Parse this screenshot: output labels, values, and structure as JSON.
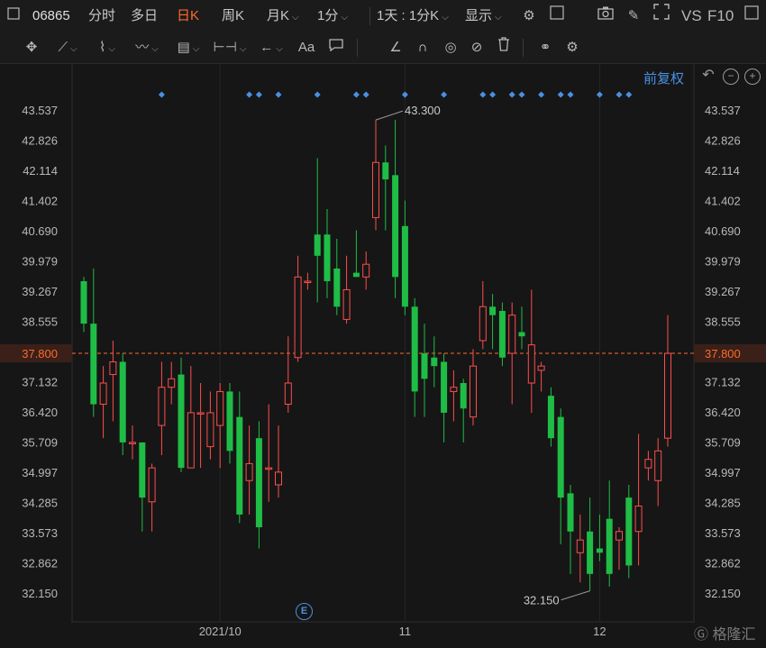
{
  "toolbar": {
    "stock_code": "06865",
    "tabs": [
      {
        "label": "分时",
        "active": false
      },
      {
        "label": "多日",
        "active": false
      },
      {
        "label": "日K",
        "active": true
      },
      {
        "label": "周K",
        "active": false
      },
      {
        "label": "月K",
        "active": false
      },
      {
        "label": "1分",
        "active": false
      },
      {
        "label": "1天 : 1分K",
        "active": false
      },
      {
        "label": "显示",
        "active": false
      }
    ],
    "vs_label": "VS",
    "f10_label": "F10",
    "draw_tools": {
      "text_tool": "Aa"
    }
  },
  "adjust": {
    "label": "前复权"
  },
  "colors": {
    "up": "#ff4d4d",
    "down": "#1fbd46",
    "accent": "#ff6a2c",
    "link": "#4a90e2"
  },
  "chart_data": {
    "type": "candlestick",
    "price_ticks": [
      "43.537",
      "42.826",
      "42.114",
      "41.402",
      "40.690",
      "39.979",
      "39.267",
      "38.555",
      "37.800",
      "37.132",
      "36.420",
      "35.709",
      "34.997",
      "34.285",
      "33.573",
      "32.862",
      "32.150"
    ],
    "current_price": "37.800",
    "x_labels": [
      {
        "label": "2021/10",
        "index": 14
      },
      {
        "label": "11",
        "index": 33
      },
      {
        "label": "12",
        "index": 53
      }
    ],
    "annotations": {
      "high": "43.300",
      "low": "32.150"
    },
    "event_badge": "E",
    "marker_indices": [
      8,
      17,
      18,
      20,
      24,
      28,
      29,
      33,
      37,
      41,
      42,
      44,
      45,
      47,
      49,
      50,
      53,
      55,
      56
    ],
    "candles": [
      [
        39.5,
        38.5,
        39.6,
        38.3
      ],
      [
        38.5,
        36.6,
        39.8,
        36.3
      ],
      [
        36.6,
        37.1,
        37.5,
        35.8
      ],
      [
        37.3,
        37.6,
        38.1,
        36.2
      ],
      [
        37.6,
        35.7,
        37.8,
        35.4
      ],
      [
        35.7,
        35.7,
        36.1,
        35.3
      ],
      [
        35.7,
        34.4,
        35.7,
        33.6
      ],
      [
        34.3,
        35.1,
        35.2,
        33.6
      ],
      [
        36.1,
        37.0,
        37.6,
        35.4
      ],
      [
        37.0,
        37.2,
        37.6,
        36.6
      ],
      [
        37.3,
        35.1,
        37.7,
        35.0
      ],
      [
        35.1,
        36.4,
        37.5,
        35.1
      ],
      [
        36.4,
        36.4,
        37.1,
        35.1
      ],
      [
        35.6,
        36.4,
        36.9,
        35.3
      ],
      [
        36.1,
        36.9,
        37.1,
        35.1
      ],
      [
        36.9,
        35.5,
        37.1,
        35.2
      ],
      [
        36.3,
        34.0,
        36.9,
        33.8
      ],
      [
        34.8,
        35.2,
        36.1,
        34.0
      ],
      [
        35.8,
        33.7,
        36.2,
        33.2
      ],
      [
        35.1,
        35.1,
        36.6,
        34.3
      ],
      [
        34.7,
        35.0,
        36.1,
        34.4
      ],
      [
        36.6,
        37.1,
        38.2,
        36.4
      ],
      [
        37.7,
        39.6,
        40.1,
        37.6
      ],
      [
        39.5,
        39.5,
        39.7,
        39.3
      ],
      [
        40.6,
        40.1,
        42.4,
        39.0
      ],
      [
        40.6,
        39.5,
        41.2,
        39.1
      ],
      [
        39.8,
        38.9,
        40.5,
        38.7
      ],
      [
        38.6,
        39.3,
        40.1,
        38.5
      ],
      [
        39.7,
        39.6,
        40.7,
        39.6
      ],
      [
        39.6,
        39.9,
        40.2,
        39.3
      ],
      [
        41.0,
        42.3,
        43.3,
        40.7
      ],
      [
        42.3,
        41.9,
        42.7,
        40.7
      ],
      [
        42.0,
        39.6,
        43.3,
        39.1
      ],
      [
        40.8,
        38.9,
        41.4,
        38.7
      ],
      [
        38.9,
        36.9,
        39.1,
        36.3
      ],
      [
        37.8,
        37.2,
        38.5,
        36.3
      ],
      [
        37.7,
        37.5,
        38.2,
        37.0
      ],
      [
        37.6,
        36.4,
        37.8,
        35.7
      ],
      [
        36.9,
        37.0,
        37.4,
        36.2
      ],
      [
        37.1,
        36.5,
        37.2,
        35.7
      ],
      [
        36.3,
        37.5,
        37.9,
        36.1
      ],
      [
        38.1,
        38.9,
        39.5,
        37.9
      ],
      [
        38.9,
        38.7,
        39.2,
        37.9
      ],
      [
        38.8,
        37.7,
        39.0,
        37.5
      ],
      [
        37.8,
        38.7,
        39.0,
        36.6
      ],
      [
        38.3,
        38.2,
        38.9,
        37.9
      ],
      [
        37.1,
        38.0,
        39.3,
        36.4
      ],
      [
        37.4,
        37.5,
        37.6,
        36.9
      ],
      [
        36.8,
        35.8,
        37.0,
        35.6
      ],
      [
        36.3,
        34.4,
        36.5,
        33.3
      ],
      [
        34.5,
        33.6,
        34.7,
        32.6
      ],
      [
        33.1,
        33.4,
        34.0,
        32.4
      ],
      [
        33.6,
        32.6,
        34.4,
        32.2
      ],
      [
        33.2,
        33.1,
        34.0,
        32.9
      ],
      [
        33.9,
        32.6,
        34.8,
        32.3
      ],
      [
        33.4,
        33.6,
        33.7,
        32.7
      ],
      [
        34.4,
        32.8,
        34.7,
        32.5
      ],
      [
        33.6,
        34.2,
        35.9,
        32.8
      ],
      [
        35.1,
        35.3,
        35.5,
        34.8
      ],
      [
        34.8,
        35.5,
        35.8,
        34.2
      ],
      [
        35.8,
        37.8,
        38.7,
        35.6
      ]
    ]
  }
}
